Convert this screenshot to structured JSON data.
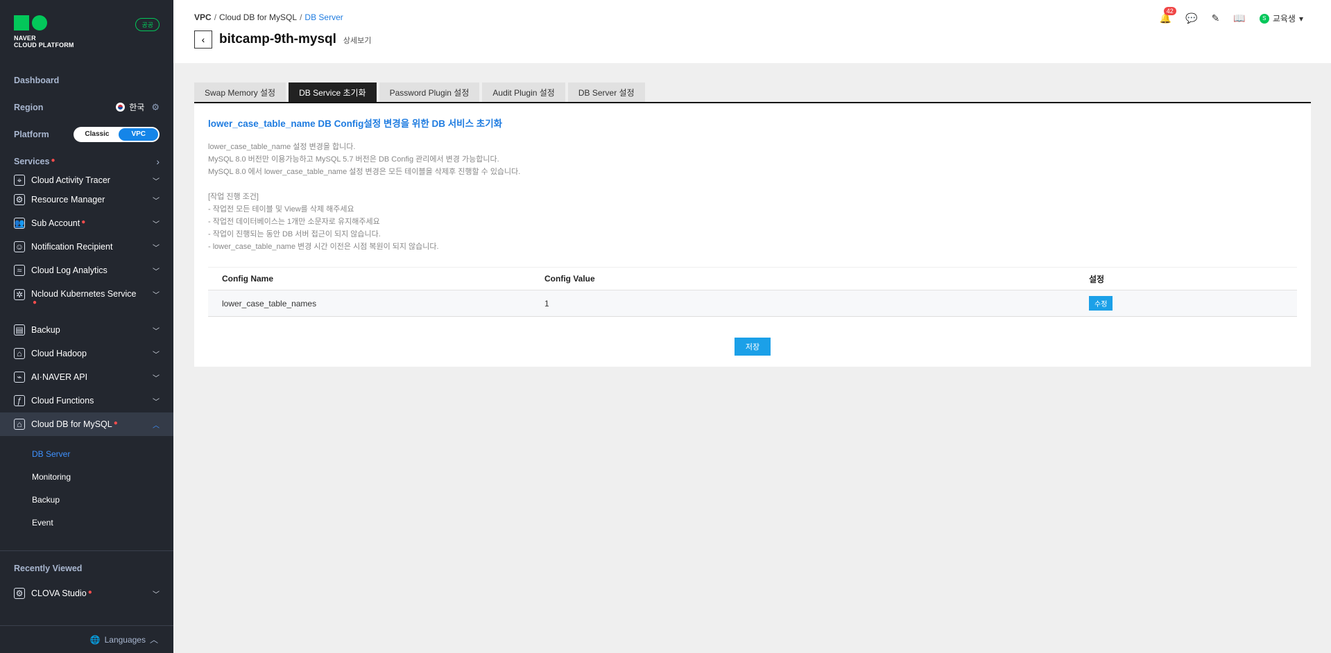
{
  "brand": {
    "line1": "NAVER",
    "line2": "CLOUD PLATFORM",
    "gov_badge": "공공"
  },
  "sidebar": {
    "dashboard": "Dashboard",
    "region_label": "Region",
    "region_value": "한국",
    "platform_label": "Platform",
    "platform_options": [
      "Classic",
      "VPC"
    ],
    "services_label": "Services",
    "items": [
      {
        "label": "Cloud Activity Tracer"
      },
      {
        "label": "Resource Manager"
      },
      {
        "label": "Sub Account"
      },
      {
        "label": "Notification Recipient"
      },
      {
        "label": "Cloud Log Analytics"
      },
      {
        "label": "Ncloud Kubernetes Service"
      },
      {
        "label": "Backup"
      },
      {
        "label": "Cloud Hadoop"
      },
      {
        "label": "AI·NAVER API"
      },
      {
        "label": "Cloud Functions"
      },
      {
        "label": "Cloud DB for MySQL"
      }
    ],
    "subitems": [
      "DB Server",
      "Monitoring",
      "Backup",
      "Event"
    ],
    "recent_label": "Recently Viewed",
    "recent_items": [
      {
        "label": "CLOVA Studio"
      }
    ],
    "languages": "Languages"
  },
  "header": {
    "breadcrumb": [
      "VPC",
      "Cloud DB for MySQL",
      "DB Server"
    ],
    "title": "bitcamp-9th-mysql",
    "detail": "상세보기",
    "notification_count": "42",
    "user_initial": "S",
    "user_name": "교육생"
  },
  "tabs": [
    "Swap Memory 설정",
    "DB Service 초기화",
    "Password Plugin 설정",
    "Audit Plugin 설정",
    "DB Server 설정"
  ],
  "panel": {
    "title": "lower_case_table_name DB Config설정 변경을 위한 DB 서비스 초기화",
    "description": "lower_case_table_name 설정 변경을 합니다.\nMySQL 8.0 버전만 이용가능하고 MySQL 5.7 버전은 DB Config 관리에서 변경 가능합니다.\nMySQL 8.0 에서 lower_case_table_name 설정 변경은 모든 테이블을 삭제후 진행할 수 있습니다.\n\n[작업 진행 조건]\n- 작업전 모든 테이블 및 View를 삭제 해주세요\n- 작업전 데이터베이스는 1개만 소문자로 유지해주세요\n- 작업이 진행되는 동안 DB 서버 접근이 되지 않습니다.\n- lower_case_table_name 변경 시간 이전은 시점 복원이 되지 않습니다.",
    "table": {
      "headers": [
        "Config Name",
        "Config Value",
        "설정"
      ],
      "rows": [
        {
          "name": "lower_case_table_names",
          "value": "1",
          "action": "수정"
        }
      ]
    },
    "save_label": "저장"
  }
}
